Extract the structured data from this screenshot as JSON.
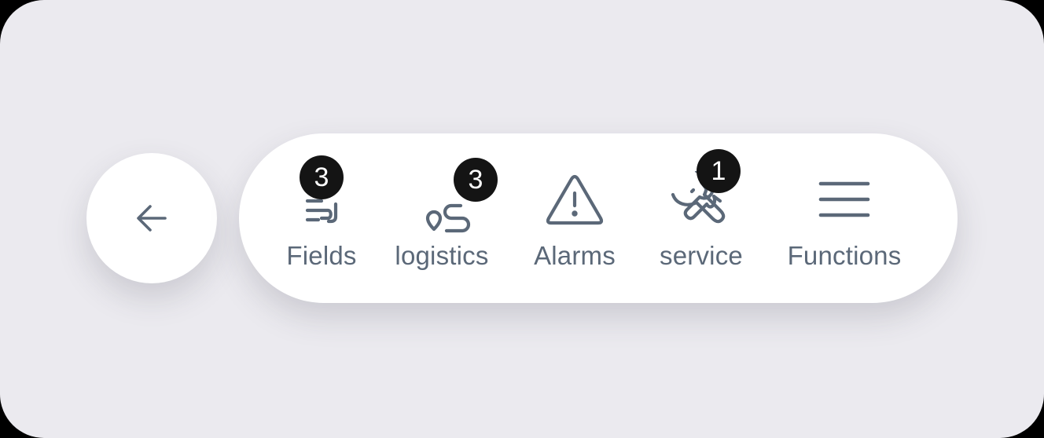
{
  "back": {
    "icon": "arrow-left-icon"
  },
  "nav": {
    "items": [
      {
        "key": "fields",
        "label": "Fields",
        "icon": "fields-icon",
        "badge": "3"
      },
      {
        "key": "logistics",
        "label": "logistics",
        "icon": "route-icon",
        "badge": "3"
      },
      {
        "key": "alarms",
        "label": "Alarms",
        "icon": "alert-triangle-icon",
        "badge": ""
      },
      {
        "key": "service",
        "label": "service",
        "icon": "wrench-icon",
        "badge": "1"
      },
      {
        "key": "functions",
        "label": "Functions",
        "icon": "menu-icon",
        "badge": ""
      }
    ]
  },
  "colors": {
    "background": "#ebeaef",
    "surface": "#ffffff",
    "icon": "#5b6878",
    "badge": "#141414",
    "badge_text": "#ffffff"
  }
}
